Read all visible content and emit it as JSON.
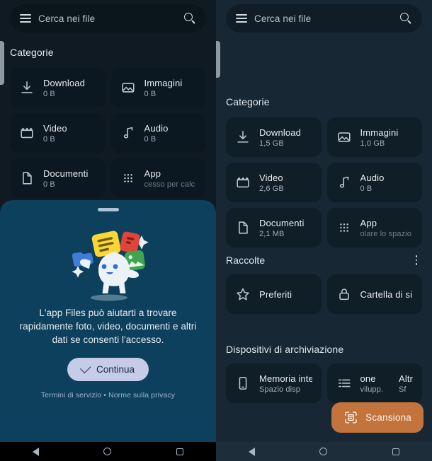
{
  "left_phone": {
    "search": {
      "placeholder": "Cerca nei file",
      "menu_icon": "hamburger-icon",
      "search_icon": "search-icon"
    },
    "categories_title": "Categorie",
    "categories": [
      {
        "name": "Download",
        "size": "0 B",
        "icon": "download-icon"
      },
      {
        "name": "Immagini",
        "size": "0 B",
        "icon": "image-icon"
      },
      {
        "name": "Video",
        "size": "0 B",
        "icon": "video-icon"
      },
      {
        "name": "Audio",
        "size": "0 B",
        "icon": "audio-icon"
      },
      {
        "name": "Documenti",
        "size": "0 B",
        "icon": "document-icon"
      },
      {
        "name": "App",
        "size": "cesso per calc",
        "icon": "apps-grid-icon"
      }
    ],
    "sheet": {
      "body": "L'app Files può aiutarti a trovare rapidamente foto, video, documenti e altri dati se consenti l'accesso.",
      "cta_label": "Continua",
      "cta_icon": "check-icon",
      "legal": "Termini di servizio • Norme sulla privacy"
    }
  },
  "right_phone": {
    "search": {
      "placeholder": "Cerca nei file",
      "menu_icon": "hamburger-icon",
      "search_icon": "search-icon"
    },
    "categories_title": "Categorie",
    "categories": [
      {
        "name": "Download",
        "size": "1,5 GB",
        "icon": "download-icon"
      },
      {
        "name": "Immagini",
        "size": "1,0 GB",
        "icon": "image-icon"
      },
      {
        "name": "Video",
        "size": "2,6 GB",
        "icon": "video-icon"
      },
      {
        "name": "Audio",
        "size": "0 B",
        "icon": "audio-icon"
      },
      {
        "name": "Documenti",
        "size": "2,1 MB",
        "icon": "document-icon"
      },
      {
        "name": "App",
        "size": "olare lo spazio",
        "icon": "apps-grid-icon"
      }
    ],
    "collections_title": "Raccolte",
    "collections_menu_icon": "kebab-menu-icon",
    "collections": [
      {
        "name": "Preferiti",
        "icon": "star-icon"
      },
      {
        "name": "Cartella di si",
        "icon": "lock-icon"
      }
    ],
    "storage_title": "Dispositivi di archiviazione",
    "storage": [
      {
        "name": "Memoria inte",
        "sub": "Spazio disp",
        "icon": "phone-icon"
      },
      {
        "name_a": "one",
        "sub_a": "vilupp.",
        "name_b": "Altro",
        "sub_b": "Sf",
        "icon": "list-icon"
      }
    ],
    "fab": {
      "label": "Scansiona",
      "icon": "scan-document-icon"
    }
  },
  "navbar": {
    "back_icon": "back-triangle-icon",
    "home_icon": "home-circle-icon",
    "recents_icon": "recents-square-icon"
  },
  "colors": {
    "left_bg": "#0f1a22",
    "right_bg": "#172734",
    "tile_bg": "#101e28",
    "sheet_bg": "#0c405c",
    "cta_bg": "#c6cbea",
    "fab_orange": "#c2743c"
  }
}
